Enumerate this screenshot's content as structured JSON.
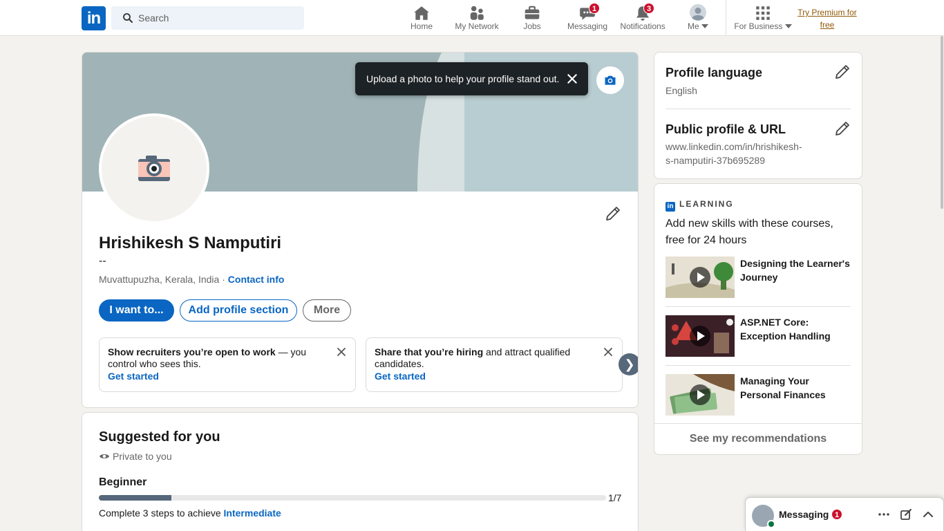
{
  "nav": {
    "logo_text": "in",
    "search_placeholder": "Search",
    "items": [
      {
        "label": "Home",
        "icon": "home-icon"
      },
      {
        "label": "My Network",
        "icon": "network-icon"
      },
      {
        "label": "Jobs",
        "icon": "briefcase-icon"
      },
      {
        "label": "Messaging",
        "icon": "messaging-icon",
        "badge": "1"
      },
      {
        "label": "Notifications",
        "icon": "bell-icon",
        "badge": "3"
      },
      {
        "label": "Me",
        "icon": "avatar"
      },
      {
        "label": "For Business",
        "icon": "grid-icon"
      }
    ],
    "premium": "Try Premium for free",
    "brand_color": "#0a66c2",
    "badge_color": "#cb112d"
  },
  "profile": {
    "toast": "Upload a photo to help your profile stand out.",
    "name": "Hrishikesh S Namputiri",
    "headline": "--",
    "location": "Muvattupuzha, Kerala, India",
    "location_sep": " · ",
    "contact_info": "Contact info",
    "buttons": {
      "primary": "I want to...",
      "add_section": "Add profile section",
      "more": "More"
    },
    "promos": [
      {
        "bold": "Show recruiters you’re open to work",
        "rest": " — you control who sees this.",
        "link": "Get started"
      },
      {
        "bold": "Share that you’re hiring",
        "rest": " and attract qualified candidates.",
        "link": "Get started"
      }
    ],
    "carousel_next": "❯"
  },
  "suggested": {
    "title": "Suggested for you",
    "private": "Private to you",
    "level": "Beginner",
    "progress": {
      "current": 1,
      "total": 7,
      "label": "1/7"
    },
    "achieve_prefix": "Complete 3 steps to achieve ",
    "achieve_link": "Intermediate"
  },
  "right": {
    "profile_language_title": "Profile language",
    "profile_language_value": "English",
    "public_profile_title": "Public profile & URL",
    "public_profile_url_line1": "www.linkedin.com/in/hrishikesh-",
    "public_profile_url_line2": "s-namputiri-37b695289",
    "learning_label": "LEARNING",
    "learning_intro": "Add new skills with these courses, free for 24 hours",
    "courses": [
      {
        "title": "Designing the Learner's Journey"
      },
      {
        "title": "ASP.NET Core: Exception Handling"
      },
      {
        "title": "Managing Your Personal Finances"
      }
    ],
    "see_recommendations": "See my recommendations"
  },
  "messaging_bar": {
    "label": "Messaging",
    "badge": "1"
  }
}
